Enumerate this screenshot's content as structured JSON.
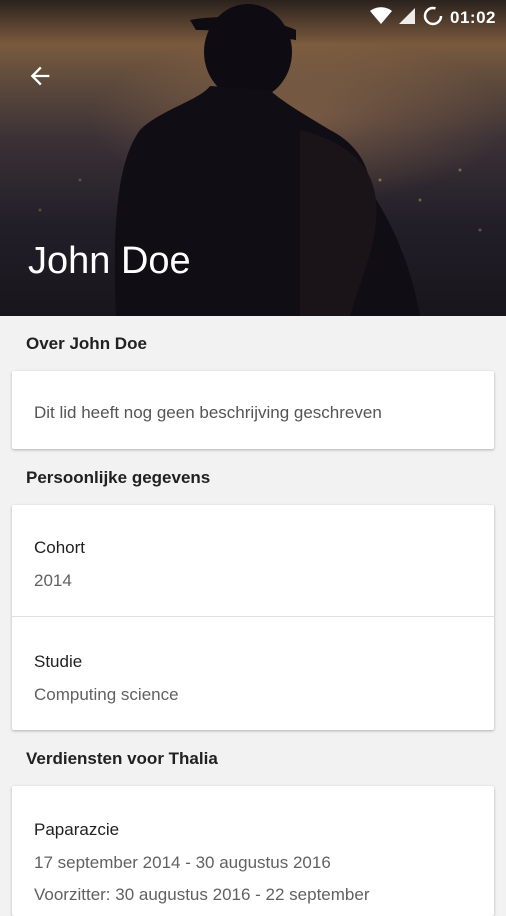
{
  "status_bar": {
    "time": "01:02"
  },
  "header": {
    "name": "John Doe"
  },
  "about": {
    "title": "Over John Doe",
    "description": "Dit lid heeft nog geen beschrijving geschreven"
  },
  "personal": {
    "title": "Persoonlijke gegevens",
    "items": [
      {
        "label": "Cohort",
        "value": "2014"
      },
      {
        "label": "Studie",
        "value": "Computing science"
      }
    ]
  },
  "merits": {
    "title": "Verdiensten voor Thalia",
    "items": [
      {
        "label": "Paparazcie",
        "lines": [
          "17 september 2014 - 30 augustus 2016",
          "Voorzitter: 30 augustus 2016 - 22 september"
        ]
      }
    ]
  }
}
